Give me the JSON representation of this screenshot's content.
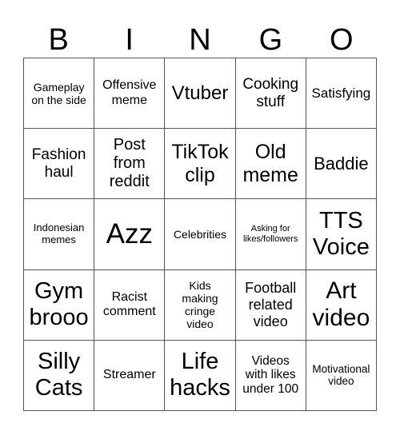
{
  "header": [
    "B",
    "I",
    "N",
    "G",
    "O"
  ],
  "cells": [
    "Gameplay on the side",
    "Offensive meme",
    "Vtuber",
    "Cooking stuff",
    "Satisfying",
    "Fashion haul",
    "Post from reddit",
    "TikTok clip",
    "Old meme",
    "Baddie",
    "Indonesian memes",
    "Azz",
    "Celebrities",
    "Asking for likes/followers",
    "TTS Voice",
    "Gym brooo",
    "Racist comment",
    "Kids making cringe video",
    "Football related video",
    "Art video",
    "Silly Cats",
    "Streamer",
    "Life hacks",
    "Videos with likes under 100",
    "Motivational video"
  ]
}
